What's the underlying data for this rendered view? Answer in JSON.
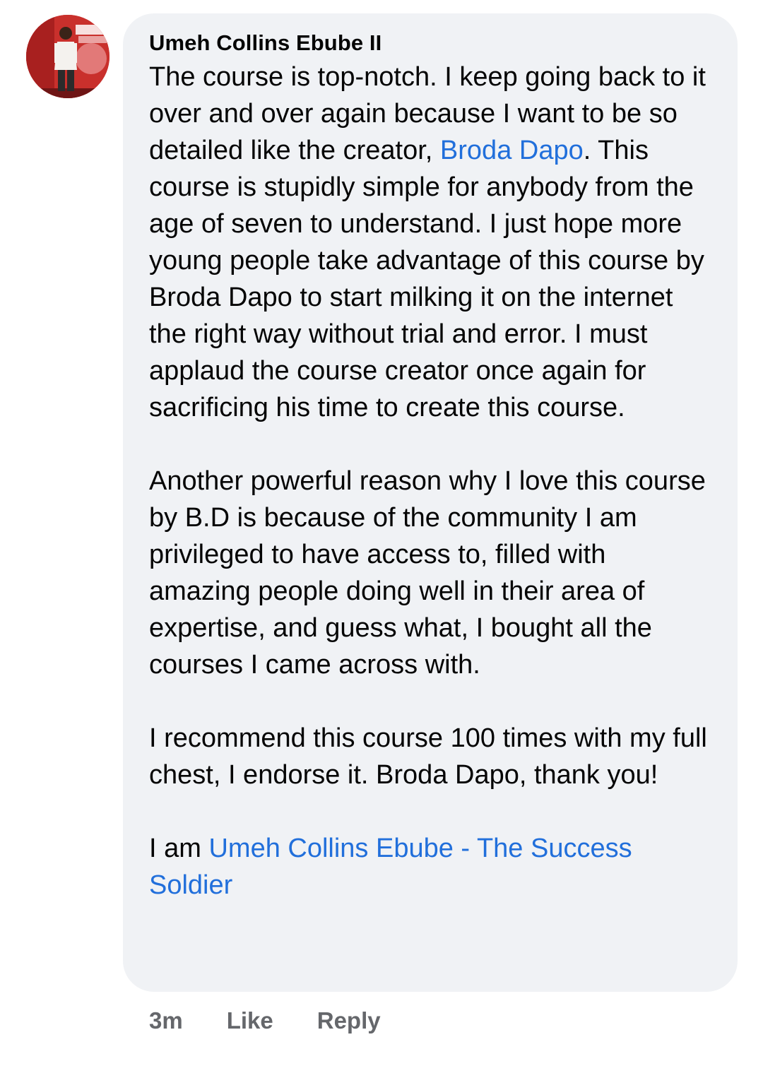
{
  "comment": {
    "author": "Umeh Collins Ebube II",
    "avatar_icon": "profile-photo",
    "paragraph1": {
      "before_link": "The course is top-notch. I keep going back to it over and over again because I want to be so detailed like the creator, ",
      "link_text": "Broda Dapo",
      "after_link": ". This course is stupidly simple for anybody from the age of seven to understand. I just hope more young people take advantage of this course by Broda Dapo to start milking it on the internet the right way without trial and error. I must applaud the course creator once again for sacrificing his time to create this course."
    },
    "paragraph2": "Another powerful reason why I love this course by B.D is because of the community I am privileged to have access to, filled with amazing people doing well in their area of expertise, and guess what,  I bought all the courses I came across with.",
    "paragraph3": "I recommend this course 100 times with my full chest, I endorse it. Broda Dapo, thank you!",
    "paragraph4": {
      "before_link": "I am ",
      "link_text": "Umeh Collins Ebube - The Success Soldier"
    }
  },
  "actions": {
    "time": "3m",
    "like_label": "Like",
    "reply_label": "Reply"
  },
  "colors": {
    "bubble_bg": "#f0f2f5",
    "link": "#216fdb",
    "meta": "#65676b",
    "text": "#050505"
  }
}
